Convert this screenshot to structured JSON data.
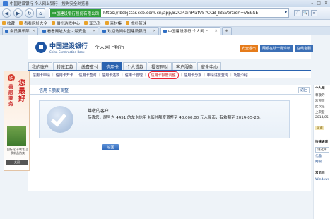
{
  "browser": {
    "title": "中国建设银行 个人网上银行 - 搜狗安全浏览器",
    "url": "https://ibsbjstar.ccb.com.cn/app/B2CMainPlatV5?CCB_IBSVersion=V5&SE",
    "cert_label": "中国建设银行股份有限公司",
    "favorites": [
      "收藏",
      "看看网址大全",
      "猫扑游戏中心",
      "亚马逊",
      "素材集",
      "虎扑篮球"
    ],
    "tabs": [
      {
        "label": "会员俱乐部",
        "active": false
      },
      {
        "label": "看看网址大全 - 最安全...",
        "active": false
      },
      {
        "label": "欢迎访问中国建设银行...",
        "active": false
      },
      {
        "label": "中国建设银行 个人网上...",
        "active": true
      }
    ],
    "new_tab": "+"
  },
  "bank": {
    "name": "中国建设银行",
    "name_en": "China Construction Bank",
    "portal": "个人网上银行",
    "header_buttons": [
      "安全退出",
      "网银在线一键诊断",
      "在线客服"
    ]
  },
  "main_nav": [
    {
      "label": "我的账户",
      "active": false
    },
    {
      "label": "转账汇款",
      "active": false
    },
    {
      "label": "缴费支付",
      "active": false
    },
    {
      "label": "信用卡",
      "active": true
    },
    {
      "label": "个人贷款",
      "active": false
    },
    {
      "label": "投资理财",
      "active": false
    },
    {
      "label": "客户服务",
      "active": false
    },
    {
      "label": "安全中心",
      "active": false
    }
  ],
  "sub_nav": [
    {
      "label": "信用卡申请",
      "current": false
    },
    {
      "label": "信用卡开卡",
      "current": false
    },
    {
      "label": "信用卡查询",
      "current": false
    },
    {
      "label": "信用卡还款",
      "current": false
    },
    {
      "label": "信用卡管理",
      "current": false
    },
    {
      "label": "信用卡额度调整",
      "current": true
    },
    {
      "label": "信用卡分期",
      "current": false
    },
    {
      "label": "申请进度查询",
      "current": false
    },
    {
      "label": "功能介绍",
      "current": false
    }
  ],
  "content": {
    "section_title": "信用卡额度调整",
    "back_label": "返回",
    "greeting": "尊敬的客户：",
    "message": "恭喜您，尾号为 4451 的龙卡信用卡临时额度调整至 48,000.00 元人民币，有效期至 2014-05-23。",
    "confirm_button": "返回"
  },
  "left_ad": {
    "badge": "购",
    "line1": "善融商务",
    "line2": "您最好",
    "caption": "国际化·卡联名 当季新品热卖",
    "close": "关闭"
  },
  "right_panel": {
    "heading": "个人网",
    "items": [
      "尊敬的",
      "欢迎您",
      "此次是",
      "上次登",
      "2014/05",
      "设置",
      "快速通道",
      "请选择",
      "代缴",
      "网银",
      "常见问",
      "Windows"
    ]
  }
}
